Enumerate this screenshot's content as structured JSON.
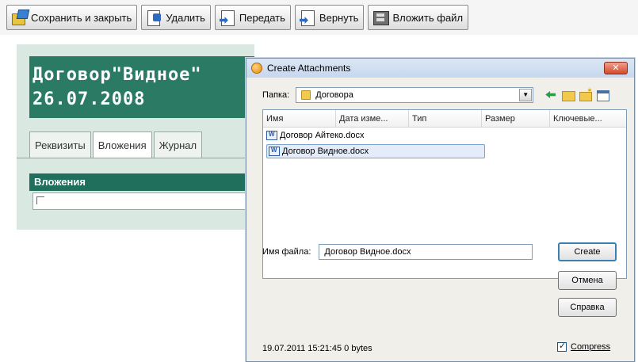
{
  "toolbar": {
    "buttons": [
      {
        "label": "Сохранить и закрыть",
        "icon": "save-close-icon"
      },
      {
        "label": "Удалить",
        "icon": "delete-icon"
      },
      {
        "label": "Передать",
        "icon": "send-icon"
      },
      {
        "label": "Вернуть",
        "icon": "return-icon"
      },
      {
        "label": "Вложить файл",
        "icon": "attach-file-icon"
      }
    ]
  },
  "document": {
    "title_line1": "Договор\"Видное\"",
    "title_line2": "26.07.2008",
    "tabs": [
      {
        "label": "Реквизиты",
        "active": false
      },
      {
        "label": "Вложения",
        "active": true
      },
      {
        "label": "Журнал",
        "active": false
      }
    ],
    "attachments_header": "Вложения",
    "colors": {
      "title_bg": "#2a7a64",
      "panel_bg": "#d9e9e2",
      "header_bg": "#1f6f5c"
    }
  },
  "dialog": {
    "title": "Create Attachments",
    "lookin_label": "Папка:",
    "lookin_value": "Договора",
    "columns": [
      "Имя",
      "Дата изме...",
      "Тип",
      "Размер",
      "Ключевые..."
    ],
    "files": [
      {
        "name": "Договор Айтеко.docx",
        "selected": false
      },
      {
        "name": "Договор Видное.docx",
        "selected": true
      }
    ],
    "filename_label": "Имя файла:",
    "filename_value": "Договор Видное.docx",
    "buttons": {
      "create": "Create",
      "cancel": "Отмена",
      "help": "Справка"
    },
    "status": "19.07.2011 15:21:45 0 bytes",
    "compress_label": "Compress",
    "compress_checked": true
  }
}
